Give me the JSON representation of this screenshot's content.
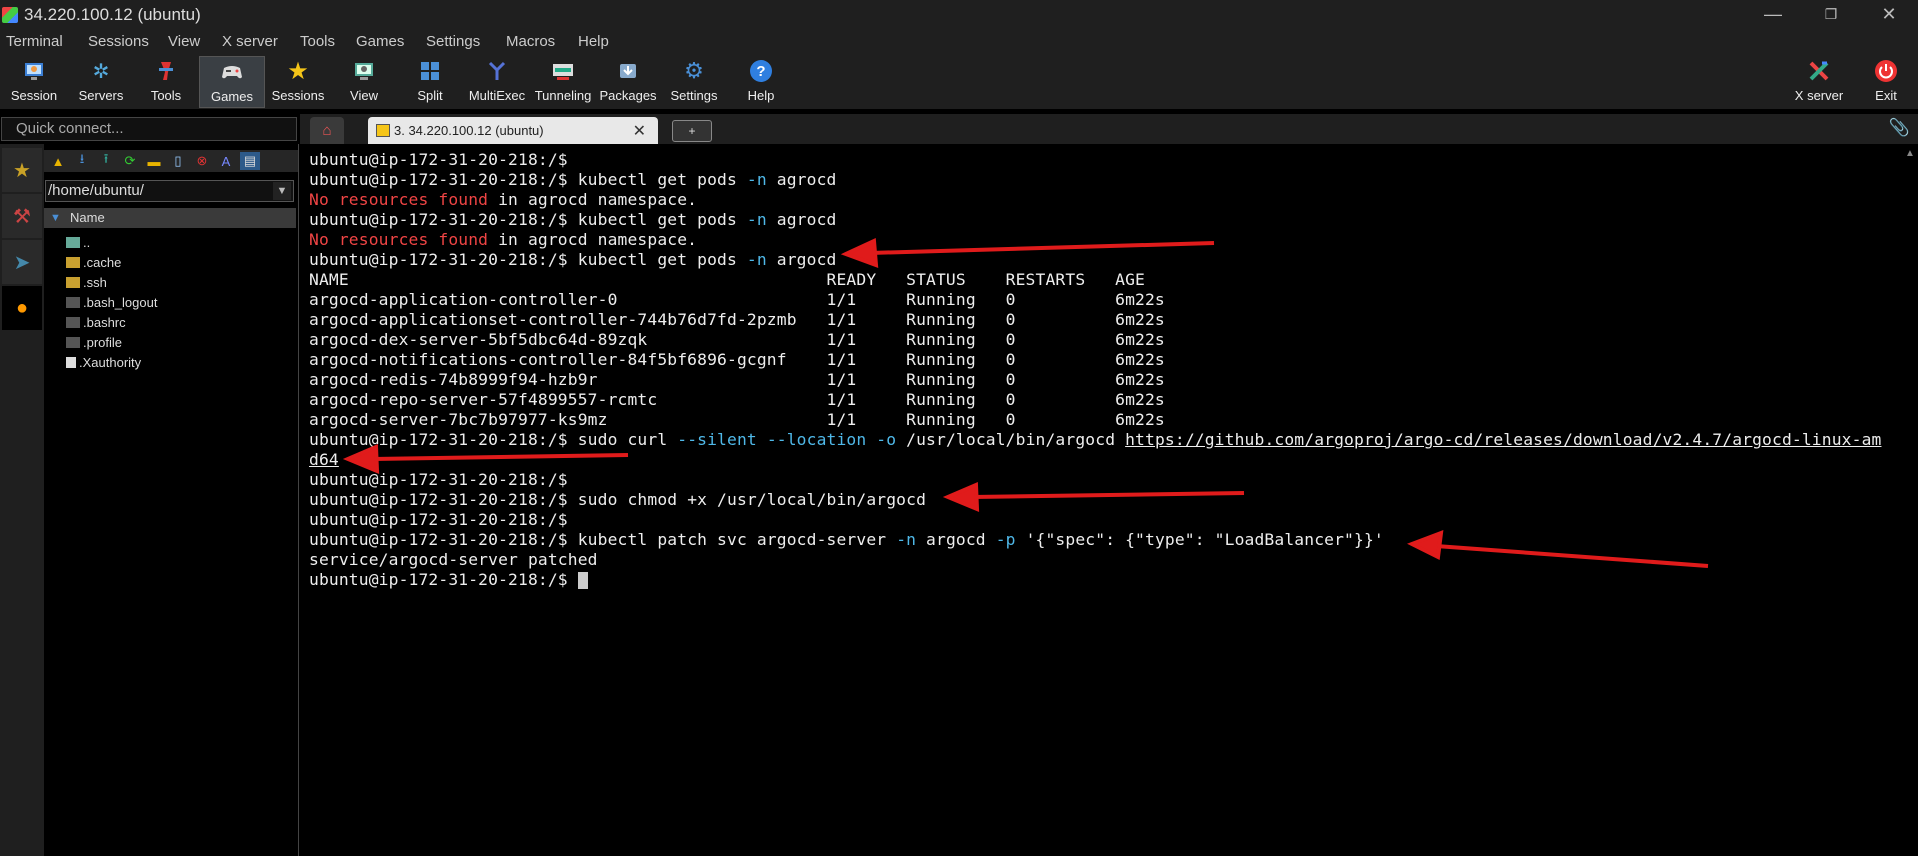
{
  "window": {
    "title": "34.220.100.12 (ubuntu)",
    "controls": [
      "—",
      "❐",
      "✕"
    ]
  },
  "menu": [
    "Terminal",
    "Sessions",
    "View",
    "X server",
    "Tools",
    "Games",
    "Settings",
    "Macros",
    "Help"
  ],
  "toolbar": {
    "left": [
      {
        "label": "Session",
        "icon": "session-icon"
      },
      {
        "label": "Servers",
        "icon": "servers-icon"
      },
      {
        "label": "Tools",
        "icon": "tools-icon"
      },
      {
        "label": "Games",
        "icon": "games-icon"
      },
      {
        "label": "Sessions",
        "icon": "star-icon"
      },
      {
        "label": "View",
        "icon": "view-icon"
      },
      {
        "label": "Split",
        "icon": "split-icon"
      },
      {
        "label": "MultiExec",
        "icon": "multiexec-icon"
      },
      {
        "label": "Tunneling",
        "icon": "tunneling-icon"
      },
      {
        "label": "Packages",
        "icon": "packages-icon"
      },
      {
        "label": "Settings",
        "icon": "gear-icon"
      },
      {
        "label": "Help",
        "icon": "help-icon"
      }
    ],
    "right": [
      {
        "label": "X server",
        "icon": "xserver-icon"
      },
      {
        "label": "Exit",
        "icon": "power-icon"
      }
    ]
  },
  "quick_connect": {
    "placeholder": "Quick connect..."
  },
  "tabs": {
    "session_label": "3. 34.220.100.12 (ubuntu)",
    "close": "✕",
    "new_tab": "+"
  },
  "sftp": {
    "path": "/home/ubuntu/",
    "column": "Name",
    "files": [
      "..",
      ".cache",
      ".ssh",
      ".bash_logout",
      ".bashrc",
      ".profile",
      ".Xauthority"
    ]
  },
  "terminal": {
    "prompt": "ubuntu@ip-172-31-20-218:/$",
    "lines": [
      {
        "prompt": "ubuntu@ip-172-31-20-218:/$",
        "text": ""
      },
      {
        "prompt": "ubuntu@ip-172-31-20-218:/$",
        "cmd": " kubectl get pods ",
        "flag": "-n",
        "rest": " agrocd"
      },
      {
        "red": "No resources found",
        "text": " in agrocd namespace."
      },
      {
        "prompt": "ubuntu@ip-172-31-20-218:/$",
        "cmd": " kubectl get pods ",
        "flag": "-n",
        "rest": " agrocd"
      },
      {
        "red": "No resources found",
        "text": " in agrocd namespace."
      },
      {
        "prompt": "ubuntu@ip-172-31-20-218:/$",
        "cmd": " kubectl get pods ",
        "flag": "-n",
        "rest": " argocd"
      },
      {
        "text": "NAME                                                READY   STATUS    RESTARTS   AGE"
      },
      {
        "text": "argocd-application-controller-0                     1/1     Running   0          6m22s"
      },
      {
        "text": "argocd-applicationset-controller-744b76d7fd-2pzmb   1/1     Running   0          6m22s"
      },
      {
        "text": "argocd-dex-server-5bf5dbc64d-89zqk                  1/1     Running   0          6m22s"
      },
      {
        "text": "argocd-notifications-controller-84f5bf6896-gcgnf    1/1     Running   0          6m22s"
      },
      {
        "text": "argocd-redis-74b8999f94-hzb9r                       1/1     Running   0          6m22s"
      },
      {
        "text": "argocd-repo-server-57f4899557-rcmtc                 1/1     Running   0          6m22s"
      },
      {
        "text": "argocd-server-7bc7b97977-ks9mz                      1/1     Running   0          6m22s"
      }
    ],
    "curl_cmd": " sudo curl ",
    "curl_flags": "--silent --location -o",
    "curl_path": " /usr/local/bin/argocd ",
    "curl_url_1": "https://github.com/argoproj/argo-cd/releases/download/v2.4.7/argocd-linux-am",
    "curl_url_2": "d64",
    "chmod_cmd": " sudo chmod +x /usr/local/bin/argocd",
    "patch_cmd": " kubectl patch svc argocd-server ",
    "patch_flag_n": "-n",
    "patch_ns": " argocd ",
    "patch_flag_p": "-p",
    "patch_json": " '{\"spec\": {\"type\": \"LoadBalancer\"}}'",
    "patch_result": "service/argocd-server patched"
  }
}
